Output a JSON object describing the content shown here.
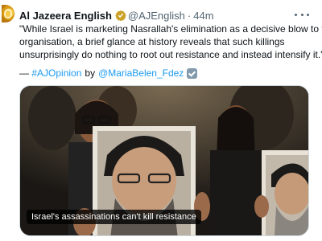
{
  "tweet": {
    "display_name": "Al Jazeera English",
    "handle": "@AJEnglish",
    "separator": "·",
    "timestamp": "44m",
    "text_lines": [
      "\"While Israel is marketing Nasrallah's elimination as a decisive blow to the",
      "organisation, a brief glance at history reveals that such killings",
      "unsurprisingly do nothing to root out resistance and instead intensify it.\""
    ],
    "byline": {
      "dash": "—",
      "hashtag": "#AJOpinion",
      "by": "by",
      "author": "@MariaBelen_Fdez"
    },
    "media": {
      "caption": "Israel's assassinations can't kill resistance"
    }
  },
  "colors": {
    "link": "#1d9bf0",
    "verified_badge": "#1d9bf0",
    "secondary_text": "#536471",
    "brand_gold": "#f7c948"
  },
  "icons": {
    "avatar": "al-jazeera-logo",
    "verified": "verified-badge-icon",
    "more": "more-options-icon",
    "affiliate": "grey-affiliate-badge-icon"
  }
}
